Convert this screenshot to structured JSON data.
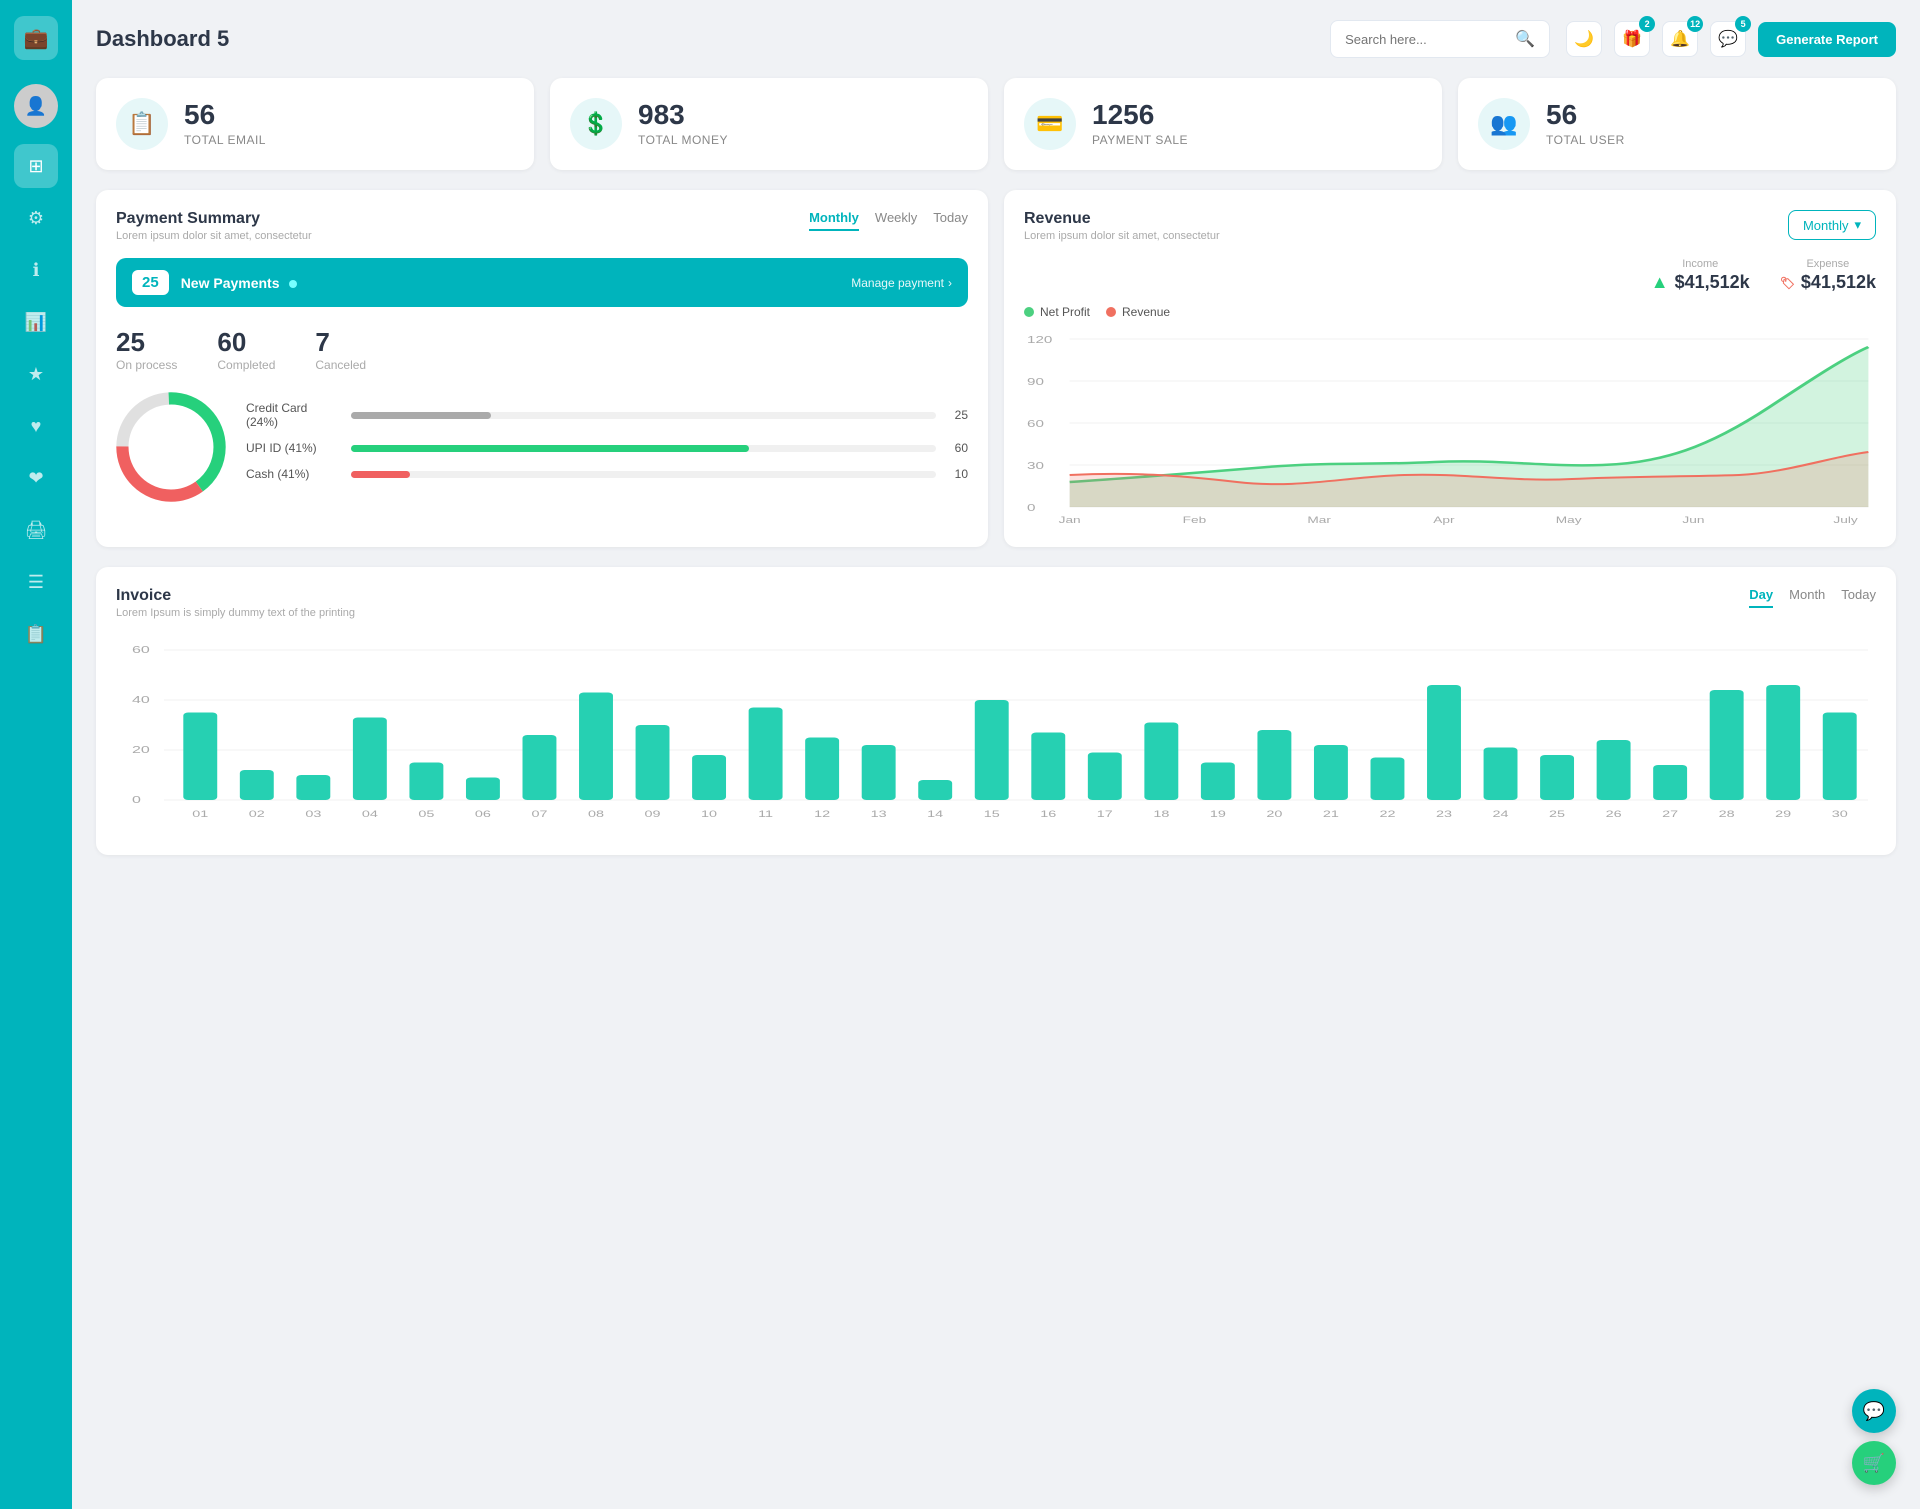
{
  "sidebar": {
    "logo_icon": "💼",
    "items": [
      {
        "id": "avatar",
        "icon": "👤",
        "active": false
      },
      {
        "id": "dashboard",
        "icon": "⊞",
        "active": true
      },
      {
        "id": "settings",
        "icon": "⚙",
        "active": false
      },
      {
        "id": "info",
        "icon": "ℹ",
        "active": false
      },
      {
        "id": "analytics",
        "icon": "📊",
        "active": false
      },
      {
        "id": "star",
        "icon": "★",
        "active": false
      },
      {
        "id": "heart",
        "icon": "♥",
        "active": false
      },
      {
        "id": "heart2",
        "icon": "❤",
        "active": false
      },
      {
        "id": "print",
        "icon": "🖨",
        "active": false
      },
      {
        "id": "menu",
        "icon": "☰",
        "active": false
      },
      {
        "id": "list",
        "icon": "📋",
        "active": false
      }
    ]
  },
  "header": {
    "title": "Dashboard 5",
    "search_placeholder": "Search here...",
    "generate_btn": "Generate Report",
    "badges": {
      "gift": "2",
      "bell": "12",
      "chat": "5"
    }
  },
  "stats": [
    {
      "id": "email",
      "value": "56",
      "label": "TOTAL EMAIL",
      "icon": "📋"
    },
    {
      "id": "money",
      "value": "983",
      "label": "TOTAL MONEY",
      "icon": "💲"
    },
    {
      "id": "payment",
      "value": "1256",
      "label": "PAYMENT SALE",
      "icon": "💳"
    },
    {
      "id": "user",
      "value": "56",
      "label": "TOTAL USER",
      "icon": "👥"
    }
  ],
  "payment_summary": {
    "title": "Payment Summary",
    "subtitle": "Lorem ipsum dolor sit amet, consectetur",
    "tabs": [
      "Monthly",
      "Weekly",
      "Today"
    ],
    "active_tab": "Monthly",
    "new_payments_count": "25",
    "new_payments_label": "New Payments",
    "manage_link": "Manage payment",
    "on_process": "25",
    "on_process_label": "On process",
    "completed": "60",
    "completed_label": "Completed",
    "canceled": "7",
    "canceled_label": "Canceled",
    "progress_items": [
      {
        "label": "Credit Card (24%)",
        "pct": 24,
        "value": "25",
        "color": "#aaa"
      },
      {
        "label": "UPI ID (41%)",
        "pct": 68,
        "value": "60",
        "color": "#26d07c"
      },
      {
        "label": "Cash (41%)",
        "pct": 10,
        "value": "10",
        "color": "#f06060"
      }
    ]
  },
  "revenue": {
    "title": "Revenue",
    "subtitle": "Lorem ipsum dolor sit amet, consectetur",
    "dropdown_label": "Monthly",
    "income_label": "Income",
    "income_value": "$41,512k",
    "expense_label": "Expense",
    "expense_value": "$41,512k",
    "legend": [
      {
        "label": "Net Profit",
        "color": "#4cd080"
      },
      {
        "label": "Revenue",
        "color": "#f07060"
      }
    ],
    "x_labels": [
      "Jan",
      "Feb",
      "Mar",
      "Apr",
      "May",
      "Jun",
      "July"
    ],
    "y_labels": [
      "120",
      "90",
      "60",
      "30",
      "0"
    ]
  },
  "invoice": {
    "title": "Invoice",
    "subtitle": "Lorem Ipsum is simply dummy text of the printing",
    "tabs": [
      "Day",
      "Month",
      "Today"
    ],
    "active_tab": "Day",
    "y_labels": [
      "60",
      "40",
      "20",
      "0"
    ],
    "x_labels": [
      "01",
      "02",
      "03",
      "04",
      "05",
      "06",
      "07",
      "08",
      "09",
      "10",
      "11",
      "12",
      "13",
      "14",
      "15",
      "16",
      "17",
      "18",
      "19",
      "20",
      "21",
      "22",
      "23",
      "24",
      "25",
      "26",
      "27",
      "28",
      "29",
      "30"
    ],
    "bars": [
      35,
      12,
      10,
      33,
      15,
      9,
      26,
      43,
      30,
      18,
      37,
      25,
      22,
      8,
      40,
      27,
      19,
      31,
      15,
      28,
      22,
      17,
      46,
      21,
      18,
      24,
      14,
      44,
      46,
      35
    ]
  },
  "fabs": [
    {
      "icon": "💬",
      "color": "#00b4bc"
    },
    {
      "icon": "🛒",
      "color": "#26d07c"
    }
  ]
}
